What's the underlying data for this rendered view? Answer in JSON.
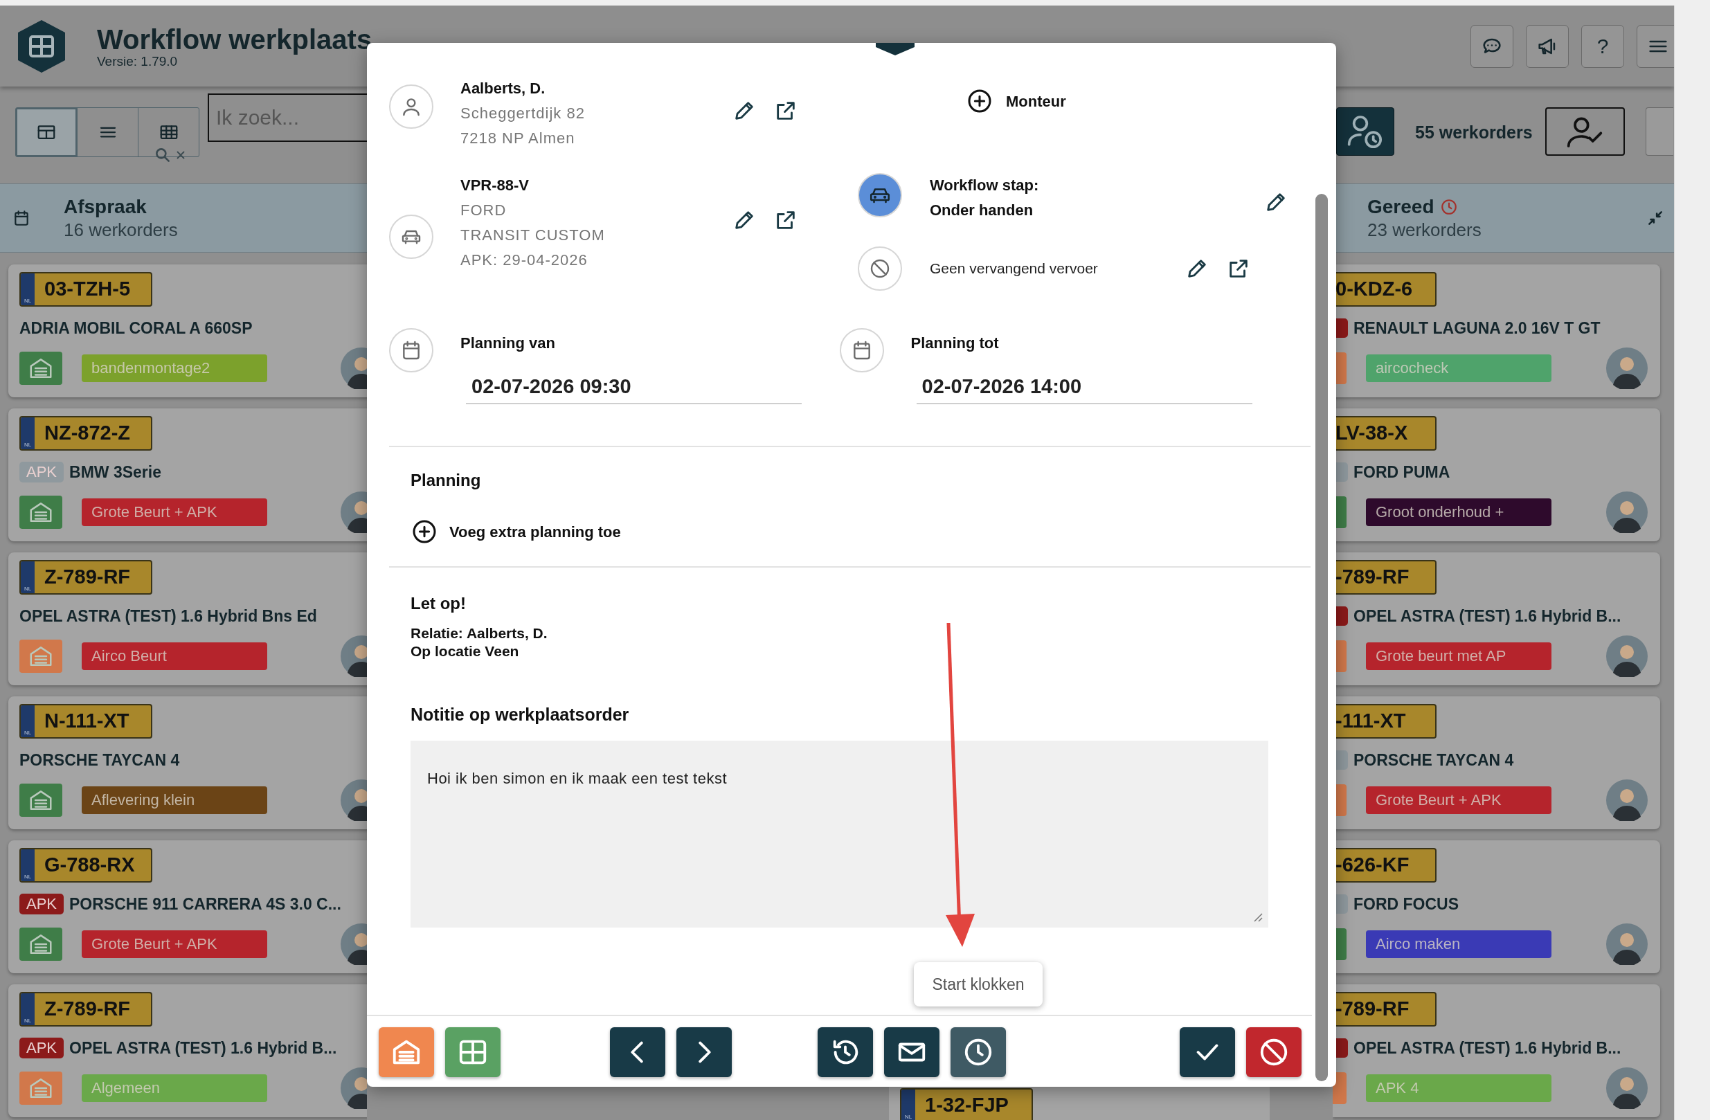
{
  "header": {
    "title": "Workflow werkplaats",
    "version": "Versie: 1.79.0"
  },
  "header_buttons": [
    {
      "kind": "chat"
    },
    {
      "kind": "megaphone"
    },
    {
      "kind": "help",
      "label": "?"
    },
    {
      "kind": "menu"
    }
  ],
  "view_toggle": [
    {
      "kind": "cards",
      "selected": true
    },
    {
      "kind": "list",
      "selected": false
    },
    {
      "kind": "grid",
      "selected": false
    }
  ],
  "search": {
    "placeholder": "Ik zoek..."
  },
  "toolbar": {
    "count": "55 werkorders"
  },
  "columns": [
    {
      "kind": "appointment",
      "title": "Afspraak",
      "count": "16 werkorders",
      "cards": [
        {
          "plate": "03-TZH-5",
          "country": "NL",
          "title": "ADRIA MOBIL CORAL A 660SP",
          "garage": {
            "color": "#3f7d48"
          },
          "tag": {
            "label": "bandenmontage2",
            "color": "#7ca12c"
          }
        },
        {
          "plate": "NZ-872-Z",
          "country": "NL",
          "apk": {
            "label": "APK",
            "color": "#8f999e"
          },
          "title": "BMW 3Serie",
          "garage": {
            "color": "#3f7d48"
          },
          "tag": {
            "label": "Grote Beurt + APK",
            "color": "#b5242c"
          }
        },
        {
          "plate": "Z-789-RF",
          "country": "NL",
          "title": "OPEL ASTRA (TEST) 1.6 Hybrid Bns Ed",
          "garage": {
            "color": "#d1784b"
          },
          "tag": {
            "label": "Airco Beurt",
            "color": "#b5242c"
          }
        },
        {
          "plate": "N-111-XT",
          "country": "NL",
          "title": "PORSCHE TAYCAN 4",
          "garage": {
            "color": "#3f7d48"
          },
          "tag": {
            "label": "Aflevering klein",
            "color": "#6b4416"
          }
        },
        {
          "plate": "G-788-RX",
          "country": "NL",
          "apk": {
            "label": "APK",
            "color": "#8c1a1a"
          },
          "title": "PORSCHE 911 CARRERA 4S 3.0 C...",
          "garage": {
            "color": "#3f7d48"
          },
          "tag": {
            "label": "Grote Beurt + APK",
            "color": "#b5242c"
          }
        },
        {
          "plate": "Z-789-RF",
          "country": "NL",
          "apk": {
            "label": "APK",
            "color": "#8c1a1a"
          },
          "title": "OPEL ASTRA (TEST) 1.6 Hybrid B...",
          "garage": {
            "color": "#d1784b"
          },
          "tag": {
            "label": "Algemeen",
            "color": "#6aa84a"
          }
        }
      ]
    },
    {
      "kind": "done",
      "title": "Gereed",
      "count": "23 werkorders",
      "cards": [
        {
          "plate": "0-KDZ-6",
          "apk": {
            "color": "#8c1a1a"
          },
          "title": "RENAULT LAGUNA 2.0 16V T GT",
          "garage": {
            "color": "#d1784b"
          },
          "tag": {
            "label": "aircocheck",
            "color": "#4fa36b"
          }
        },
        {
          "plate": "LV-38-X",
          "apk": {
            "color": "#8f999e"
          },
          "title": "FORD PUMA",
          "garage": {
            "color": "#3f7d48"
          },
          "tag": {
            "label": "Groot onderhoud +",
            "color": "#2e0a2c"
          }
        },
        {
          "plate": "-789-RF",
          "apk": {
            "color": "#8c1a1a"
          },
          "title": "OPEL ASTRA (TEST) 1.6 Hybrid B...",
          "garage": {
            "color": "#d1784b"
          },
          "tag": {
            "label": "Grote beurt met AP",
            "color": "#b5242c"
          }
        },
        {
          "plate": "-111-XT",
          "apk": {
            "color": "#8f999e"
          },
          "title": "PORSCHE TAYCAN 4",
          "garage": {
            "color": "#d1784b"
          },
          "tag": {
            "label": "Grote Beurt + APK",
            "color": "#b5242c"
          }
        },
        {
          "plate": "-626-KF",
          "apk": {
            "color": "#8f999e"
          },
          "title": "FORD FOCUS",
          "garage": {
            "color": "#3f7d48"
          },
          "tag": {
            "label": "Airco maken",
            "color": "#3a3ab5"
          }
        },
        {
          "plate": "-789-RF",
          "apk": {
            "color": "#8c1a1a"
          },
          "title": "OPEL ASTRA (TEST) 1.6 Hybrid B...",
          "garage": {
            "color": "#d1784b"
          },
          "tag": {
            "label": "APK 4",
            "color": "#6aa84a"
          }
        }
      ]
    }
  ],
  "middle_column": {
    "cards": [
      {
        "plate": "1-32-FJP",
        "country": "NL"
      }
    ]
  },
  "workorder": {
    "customer": {
      "name": "Aalberts, D.",
      "address": "Scheggertdijk 82",
      "city": "7218 NP Almen"
    },
    "mechanic": {
      "label": "Monteur"
    },
    "vehicle": {
      "plate": "VPR-88-V",
      "make": "FORD",
      "model": "TRANSIT CUSTOM",
      "apk": "APK: 29-04-2026"
    },
    "workflow": {
      "label": "Workflow stap:",
      "value": "Onder handen"
    },
    "transport": {
      "label": "Geen vervangend vervoer"
    },
    "planning_from": {
      "label": "Planning van",
      "value": "02-07-2026 09:30"
    },
    "planning_to": {
      "label": "Planning tot",
      "value": "02-07-2026 14:00"
    },
    "planning": {
      "title": "Planning",
      "add": "Voeg extra planning toe"
    },
    "notice": {
      "title": "Let op!",
      "lines": [
        "Relatie: Aalberts, D.",
        "Op locatie Veen"
      ]
    },
    "note": {
      "title": "Notitie op werkplaatsorder",
      "value": "Hoi ik ben simon en ik maak een test tekst"
    },
    "tooltip": "Start klokken",
    "footer_buttons": [
      {
        "kind": "garage",
        "hovered": false
      },
      {
        "kind": "grid",
        "hovered": false
      },
      {
        "kind": "prev",
        "hovered": false
      },
      {
        "kind": "next",
        "hovered": false
      },
      {
        "kind": "history",
        "hovered": false
      },
      {
        "kind": "mail",
        "hovered": false
      },
      {
        "kind": "clock",
        "hovered": true
      },
      {
        "kind": "confirm",
        "hovered": false
      },
      {
        "kind": "cancel",
        "hovered": false
      }
    ]
  }
}
